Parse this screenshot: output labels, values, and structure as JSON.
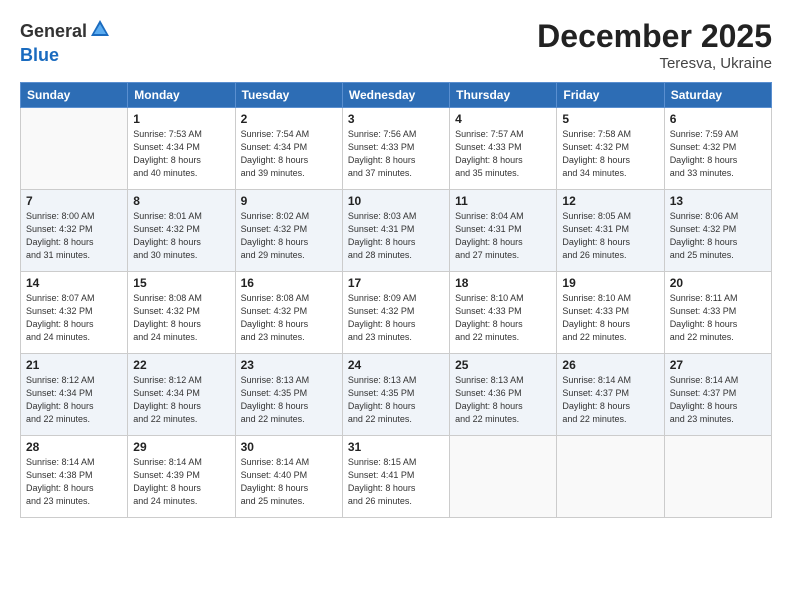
{
  "header": {
    "logo_general": "General",
    "logo_blue": "Blue",
    "title": "December 2025",
    "subtitle": "Teresva, Ukraine"
  },
  "days_of_week": [
    "Sunday",
    "Monday",
    "Tuesday",
    "Wednesday",
    "Thursday",
    "Friday",
    "Saturday"
  ],
  "weeks": [
    [
      {
        "day": "",
        "info": ""
      },
      {
        "day": "1",
        "info": "Sunrise: 7:53 AM\nSunset: 4:34 PM\nDaylight: 8 hours\nand 40 minutes."
      },
      {
        "day": "2",
        "info": "Sunrise: 7:54 AM\nSunset: 4:34 PM\nDaylight: 8 hours\nand 39 minutes."
      },
      {
        "day": "3",
        "info": "Sunrise: 7:56 AM\nSunset: 4:33 PM\nDaylight: 8 hours\nand 37 minutes."
      },
      {
        "day": "4",
        "info": "Sunrise: 7:57 AM\nSunset: 4:33 PM\nDaylight: 8 hours\nand 35 minutes."
      },
      {
        "day": "5",
        "info": "Sunrise: 7:58 AM\nSunset: 4:32 PM\nDaylight: 8 hours\nand 34 minutes."
      },
      {
        "day": "6",
        "info": "Sunrise: 7:59 AM\nSunset: 4:32 PM\nDaylight: 8 hours\nand 33 minutes."
      }
    ],
    [
      {
        "day": "7",
        "info": "Sunrise: 8:00 AM\nSunset: 4:32 PM\nDaylight: 8 hours\nand 31 minutes."
      },
      {
        "day": "8",
        "info": "Sunrise: 8:01 AM\nSunset: 4:32 PM\nDaylight: 8 hours\nand 30 minutes."
      },
      {
        "day": "9",
        "info": "Sunrise: 8:02 AM\nSunset: 4:32 PM\nDaylight: 8 hours\nand 29 minutes."
      },
      {
        "day": "10",
        "info": "Sunrise: 8:03 AM\nSunset: 4:31 PM\nDaylight: 8 hours\nand 28 minutes."
      },
      {
        "day": "11",
        "info": "Sunrise: 8:04 AM\nSunset: 4:31 PM\nDaylight: 8 hours\nand 27 minutes."
      },
      {
        "day": "12",
        "info": "Sunrise: 8:05 AM\nSunset: 4:31 PM\nDaylight: 8 hours\nand 26 minutes."
      },
      {
        "day": "13",
        "info": "Sunrise: 8:06 AM\nSunset: 4:32 PM\nDaylight: 8 hours\nand 25 minutes."
      }
    ],
    [
      {
        "day": "14",
        "info": "Sunrise: 8:07 AM\nSunset: 4:32 PM\nDaylight: 8 hours\nand 24 minutes."
      },
      {
        "day": "15",
        "info": "Sunrise: 8:08 AM\nSunset: 4:32 PM\nDaylight: 8 hours\nand 24 minutes."
      },
      {
        "day": "16",
        "info": "Sunrise: 8:08 AM\nSunset: 4:32 PM\nDaylight: 8 hours\nand 23 minutes."
      },
      {
        "day": "17",
        "info": "Sunrise: 8:09 AM\nSunset: 4:32 PM\nDaylight: 8 hours\nand 23 minutes."
      },
      {
        "day": "18",
        "info": "Sunrise: 8:10 AM\nSunset: 4:33 PM\nDaylight: 8 hours\nand 22 minutes."
      },
      {
        "day": "19",
        "info": "Sunrise: 8:10 AM\nSunset: 4:33 PM\nDaylight: 8 hours\nand 22 minutes."
      },
      {
        "day": "20",
        "info": "Sunrise: 8:11 AM\nSunset: 4:33 PM\nDaylight: 8 hours\nand 22 minutes."
      }
    ],
    [
      {
        "day": "21",
        "info": "Sunrise: 8:12 AM\nSunset: 4:34 PM\nDaylight: 8 hours\nand 22 minutes."
      },
      {
        "day": "22",
        "info": "Sunrise: 8:12 AM\nSunset: 4:34 PM\nDaylight: 8 hours\nand 22 minutes."
      },
      {
        "day": "23",
        "info": "Sunrise: 8:13 AM\nSunset: 4:35 PM\nDaylight: 8 hours\nand 22 minutes."
      },
      {
        "day": "24",
        "info": "Sunrise: 8:13 AM\nSunset: 4:35 PM\nDaylight: 8 hours\nand 22 minutes."
      },
      {
        "day": "25",
        "info": "Sunrise: 8:13 AM\nSunset: 4:36 PM\nDaylight: 8 hours\nand 22 minutes."
      },
      {
        "day": "26",
        "info": "Sunrise: 8:14 AM\nSunset: 4:37 PM\nDaylight: 8 hours\nand 22 minutes."
      },
      {
        "day": "27",
        "info": "Sunrise: 8:14 AM\nSunset: 4:37 PM\nDaylight: 8 hours\nand 23 minutes."
      }
    ],
    [
      {
        "day": "28",
        "info": "Sunrise: 8:14 AM\nSunset: 4:38 PM\nDaylight: 8 hours\nand 23 minutes."
      },
      {
        "day": "29",
        "info": "Sunrise: 8:14 AM\nSunset: 4:39 PM\nDaylight: 8 hours\nand 24 minutes."
      },
      {
        "day": "30",
        "info": "Sunrise: 8:14 AM\nSunset: 4:40 PM\nDaylight: 8 hours\nand 25 minutes."
      },
      {
        "day": "31",
        "info": "Sunrise: 8:15 AM\nSunset: 4:41 PM\nDaylight: 8 hours\nand 26 minutes."
      },
      {
        "day": "",
        "info": ""
      },
      {
        "day": "",
        "info": ""
      },
      {
        "day": "",
        "info": ""
      }
    ]
  ]
}
